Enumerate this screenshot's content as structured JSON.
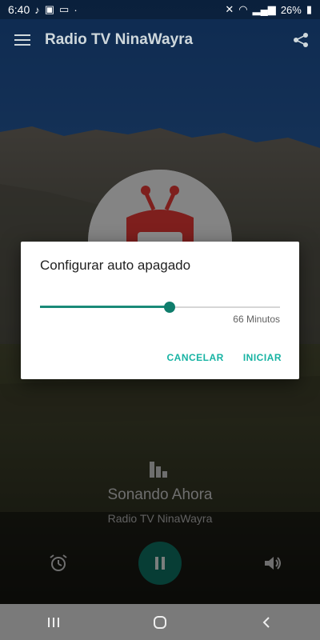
{
  "status_bar": {
    "time": "6:40",
    "battery": "26%"
  },
  "app_bar": {
    "title": "Radio TV NinaWayra"
  },
  "dialog": {
    "title": "Configurar auto apagado",
    "slider_fraction": 0.54,
    "value_label": "66 Minutos",
    "cancel_label": "CANCELAR",
    "start_label": "INICIAR"
  },
  "now_playing": {
    "heading": "Sonando Ahora",
    "station": "Radio TV NinaWayra"
  },
  "colors": {
    "accent": "#17b3a3",
    "play_button": "#0e6f61"
  },
  "icons": {
    "status_left": [
      "music-note-icon",
      "gallery-icon",
      "laptop-icon",
      "dot-icon"
    ],
    "status_right": [
      "mute-icon",
      "wifi-icon",
      "signal-icon",
      "battery-icon"
    ],
    "app_bar": [
      "menu-icon",
      "share-icon"
    ],
    "controls": [
      "alarm-icon",
      "pause-icon",
      "volume-icon"
    ],
    "nav": [
      "recents-icon",
      "home-icon",
      "back-icon"
    ]
  }
}
